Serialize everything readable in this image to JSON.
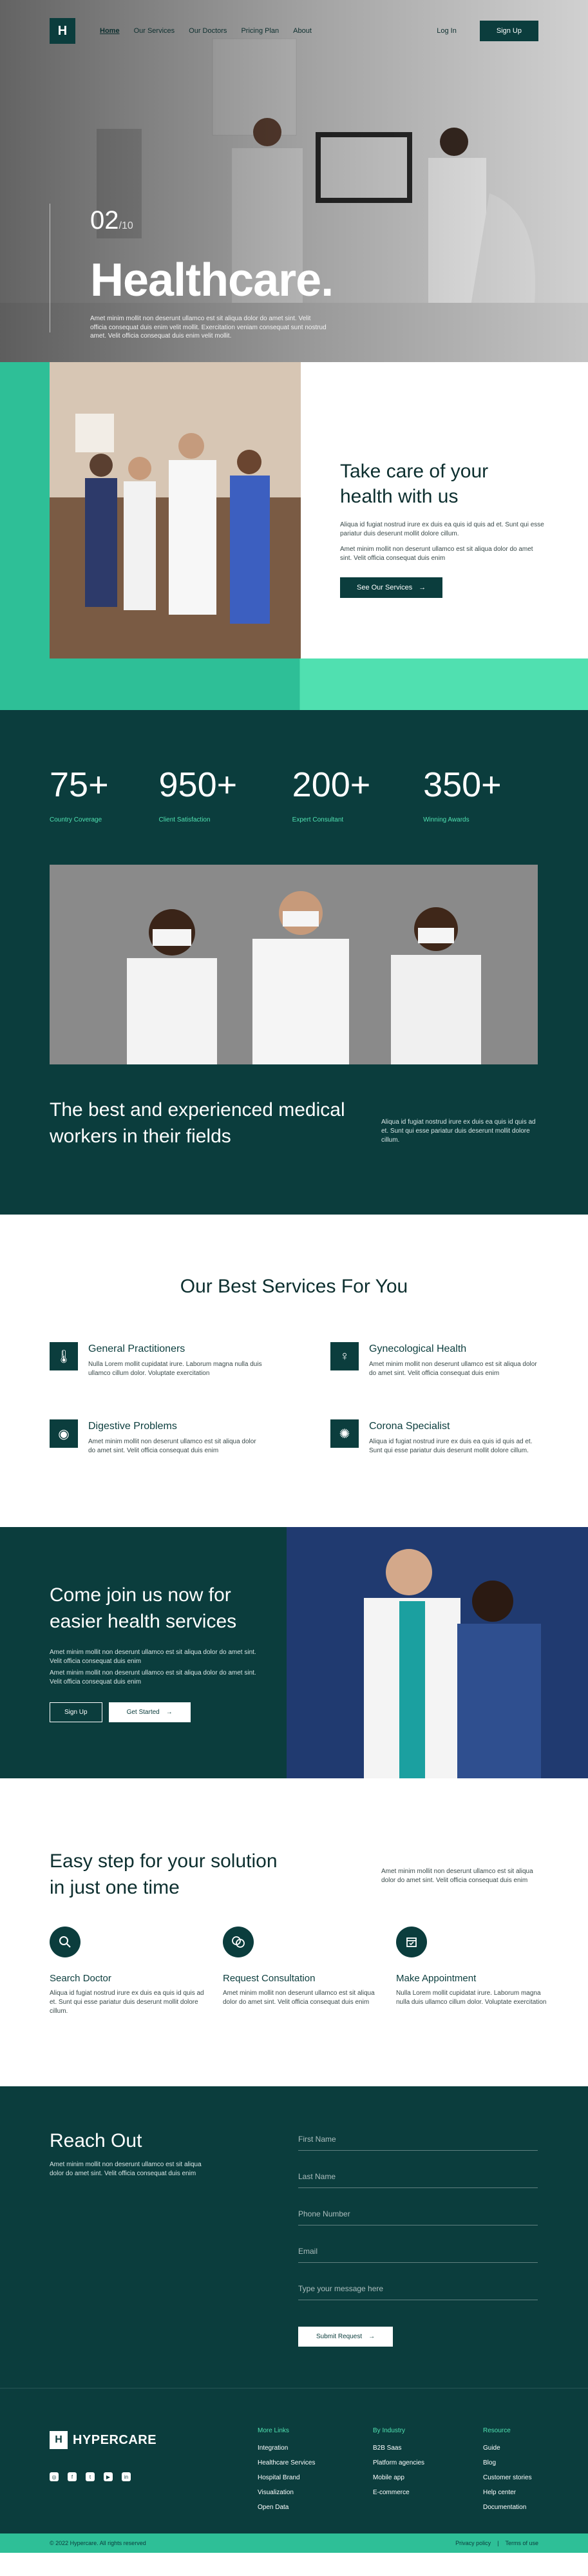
{
  "nav": {
    "logo": "H",
    "links": [
      "Home",
      "Our Services",
      "Our Doctors",
      "Pricing Plan",
      "About"
    ],
    "login": "Log In",
    "signup": "Sign Up"
  },
  "hero": {
    "counter": "02",
    "counter_total": "/10",
    "title": "Healthcare.",
    "description": "Amet minim mollit non deserunt ullamco est sit aliqua dolor do amet sint. Velit officia consequat duis enim velit mollit. Exercitation veniam consequat sunt nostrud amet. Velit officia consequat duis enim velit mollit.",
    "prev": "‹",
    "next": "›"
  },
  "care": {
    "title": "Take care of your health with us",
    "p1": "Aliqua id fugiat nostrud irure ex duis ea quis id quis ad et. Sunt qui esse pariatur duis deserunt mollit dolore cillum.",
    "p2": "Amet minim mollit non deserunt ullamco est sit aliqua dolor do amet sint. Velit officia consequat duis enim",
    "button": "See Our Services"
  },
  "stats": [
    {
      "num": "75+",
      "label": "Country Coverage"
    },
    {
      "num": "950+",
      "label": "Client Satisfaction"
    },
    {
      "num": "200+",
      "label": "Expert Consultant"
    },
    {
      "num": "350+",
      "label": "Winning Awards"
    }
  ],
  "best": {
    "title": "The best and experienced medical workers in their fields",
    "desc": "Aliqua id fugiat nostrud irure ex duis ea quis id quis ad et. Sunt qui esse pariatur duis deserunt mollit dolore cillum."
  },
  "services": {
    "title": "Our Best Services For You",
    "items": [
      {
        "title": "General Practitioners",
        "desc": "Nulla Lorem mollit cupidatat irure. Laborum magna nulla duis ullamco cillum dolor. Voluptate exercitation"
      },
      {
        "title": "Gynecological Health",
        "desc": "Amet minim mollit non deserunt ullamco est sit aliqua dolor do amet sint. Velit officia consequat duis enim"
      },
      {
        "title": "Digestive Problems",
        "desc": "Amet minim mollit non deserunt ullamco est sit aliqua dolor do amet sint. Velit officia consequat duis enim"
      },
      {
        "title": "Corona Specialist",
        "desc": "Aliqua id fugiat nostrud irure ex duis ea quis id quis ad et. Sunt qui esse pariatur duis deserunt mollit dolore cillum."
      }
    ]
  },
  "join": {
    "title": "Come join us now for easier health services",
    "p1": "Amet minim mollit non deserunt ullamco est sit aliqua dolor do amet sint. Velit officia consequat duis enim",
    "p2": "Amet minim mollit non deserunt ullamco est sit aliqua dolor do amet sint. Velit officia consequat duis enim",
    "signup": "Sign Up",
    "started": "Get Started"
  },
  "steps": {
    "title": "Easy step for your solution in just one time",
    "intro": "Amet minim mollit non deserunt ullamco est sit aliqua dolor do amet sint. Velit officia consequat duis enim",
    "items": [
      {
        "title": "Search Doctor",
        "desc": "Aliqua id fugiat nostrud irure ex duis ea quis id quis ad et. Sunt qui esse pariatur duis deserunt mollit dolore cillum."
      },
      {
        "title": "Request Consultation",
        "desc": "Amet minim mollit non deserunt ullamco est sit aliqua dolor do amet sint. Velit officia consequat duis enim"
      },
      {
        "title": "Make Appointment",
        "desc": "Nulla Lorem mollit cupidatat irure. Laborum magna nulla duis ullamco cillum dolor. Voluptate exercitation"
      }
    ]
  },
  "contact": {
    "title": "Reach Out",
    "desc": "Amet minim mollit non deserunt ullamco est sit aliqua dolor do amet sint. Velit officia consequat duis enim",
    "fields": [
      "First Name",
      "Last Name",
      "Phone Number",
      "Email",
      "Type your message here"
    ],
    "submit": "Submit Request"
  },
  "footer": {
    "logo_letter": "H",
    "logo_text": "HYPERCARE",
    "columns": [
      {
        "heading": "More Links",
        "links": [
          "Integration",
          "Healthcare Services",
          "Hospital Brand",
          "Visualization",
          "Open Data"
        ]
      },
      {
        "heading": "By Industry",
        "links": [
          "B2B Saas",
          "Platform agencies",
          "Mobile app",
          "E-commerce"
        ]
      },
      {
        "heading": "Resource",
        "links": [
          "Guide",
          "Blog",
          "Customer stories",
          "Help center",
          "Documentation"
        ]
      }
    ],
    "copyright": "© 2022 Hypercare. All rights reserved",
    "privacy": "Privacy policy",
    "separator": "|",
    "terms": "Terms of use"
  },
  "colors": {
    "dark": "#0b3d3d",
    "accent": "#2ebf97",
    "accent_light": "#50e0b0"
  }
}
